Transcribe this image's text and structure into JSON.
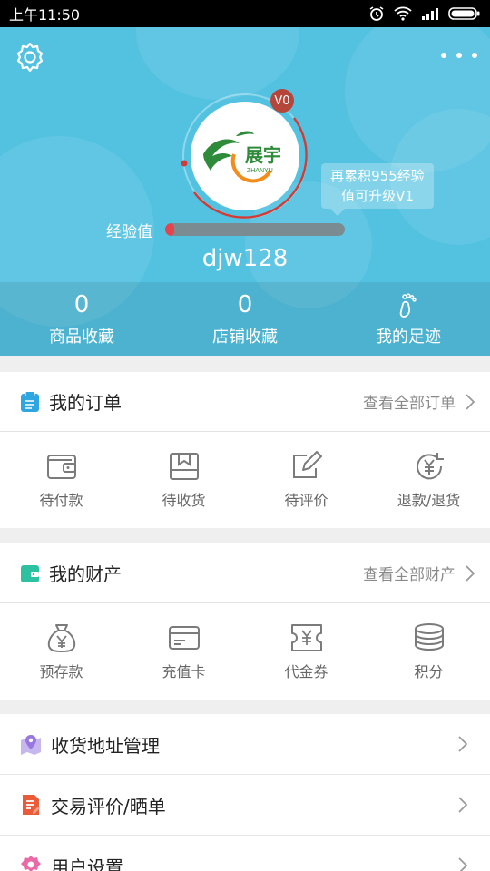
{
  "status_bar": {
    "time": "上午11:50"
  },
  "header": {
    "level_badge": "V0",
    "upgrade_tip_line1": "再累积955经验",
    "upgrade_tip_line2": "值可升级V1",
    "exp_label": "经验值",
    "exp_progress_fraction": 0.05,
    "username": "djw128",
    "logo_text": "展宇",
    "logo_subtext": "ZHANYU",
    "stats": [
      {
        "count": "0",
        "label": "商品收藏"
      },
      {
        "count": "0",
        "label": "店铺收藏"
      },
      {
        "label": "我的足迹"
      }
    ]
  },
  "orders": {
    "title": "我的订单",
    "link": "查看全部订单",
    "items": [
      {
        "label": "待付款",
        "icon": "wallet-icon"
      },
      {
        "label": "待收货",
        "icon": "package-icon"
      },
      {
        "label": "待评价",
        "icon": "edit-icon"
      },
      {
        "label": "退款/退货",
        "icon": "refund-icon"
      }
    ]
  },
  "assets": {
    "title": "我的财产",
    "link": "查看全部财产",
    "items": [
      {
        "label": "预存款",
        "icon": "money-bag-icon"
      },
      {
        "label": "充值卡",
        "icon": "card-icon"
      },
      {
        "label": "代金券",
        "icon": "voucher-icon"
      },
      {
        "label": "积分",
        "icon": "coins-icon"
      }
    ]
  },
  "menu": [
    {
      "label": "收货地址管理",
      "icon": "location-icon"
    },
    {
      "label": "交易评价/晒单",
      "icon": "review-icon"
    },
    {
      "label": "用户设置",
      "icon": "user-settings-icon"
    }
  ],
  "colors": {
    "header_bg": "#53c2e1",
    "exp_fill": "#e7434d",
    "badge": "#b6453a",
    "icon_gray": "#7b7b7b",
    "orders_icon": "#2fa6e0",
    "assets_icon": "#2cc1a0"
  }
}
